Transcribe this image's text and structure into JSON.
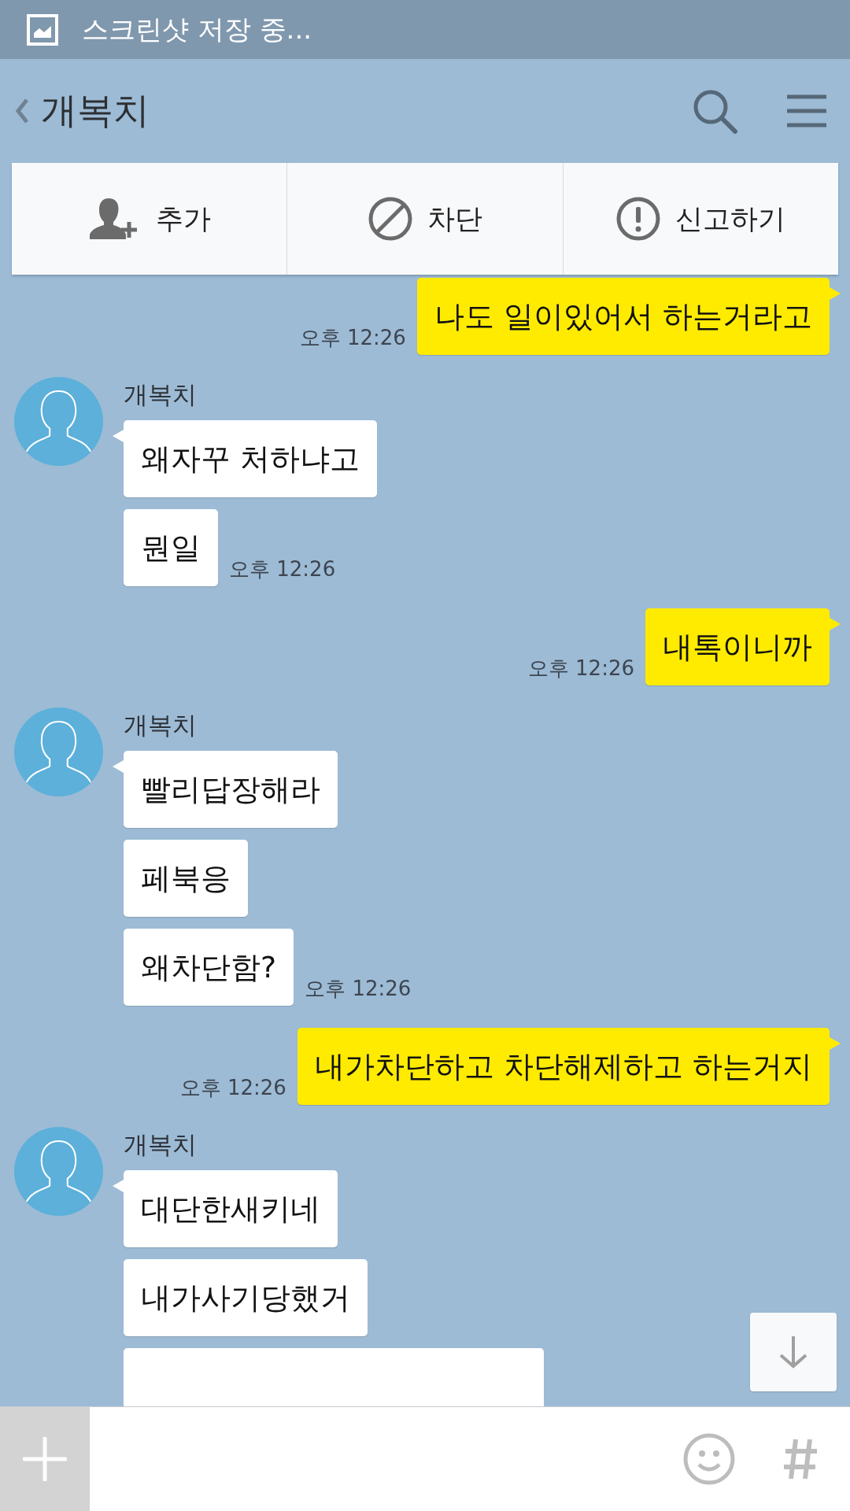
{
  "status_bar": {
    "notification": "스크린샷 저장 중..."
  },
  "header": {
    "title": "개복치"
  },
  "action_bar": [
    {
      "label": "추가",
      "kind": "add-friend"
    },
    {
      "label": "차단",
      "kind": "block"
    },
    {
      "label": "신고하기",
      "kind": "report"
    }
  ],
  "messages": [
    {
      "kind": "sent",
      "texts": [
        "나도 일이있어서 하는거라고"
      ],
      "time": "오후 12:26"
    },
    {
      "kind": "received",
      "sender": "개복치",
      "texts": [
        "왜자꾸 처하냐고",
        "뭔일"
      ],
      "time": "오후 12:26"
    },
    {
      "kind": "sent",
      "texts": [
        "내톡이니까"
      ],
      "time": "오후 12:26"
    },
    {
      "kind": "received",
      "sender": "개복치",
      "texts": [
        "빨리답장해라",
        "페북응",
        "왜차단함?"
      ],
      "time": "오후 12:26"
    },
    {
      "kind": "sent",
      "texts": [
        "내가차단하고 차단해제하고 하는거지"
      ],
      "time": "오후 12:26"
    },
    {
      "kind": "received",
      "sender": "개복치",
      "texts": [
        "대단한새키네",
        "내가사기당했거"
      ],
      "more_below": true
    }
  ]
}
